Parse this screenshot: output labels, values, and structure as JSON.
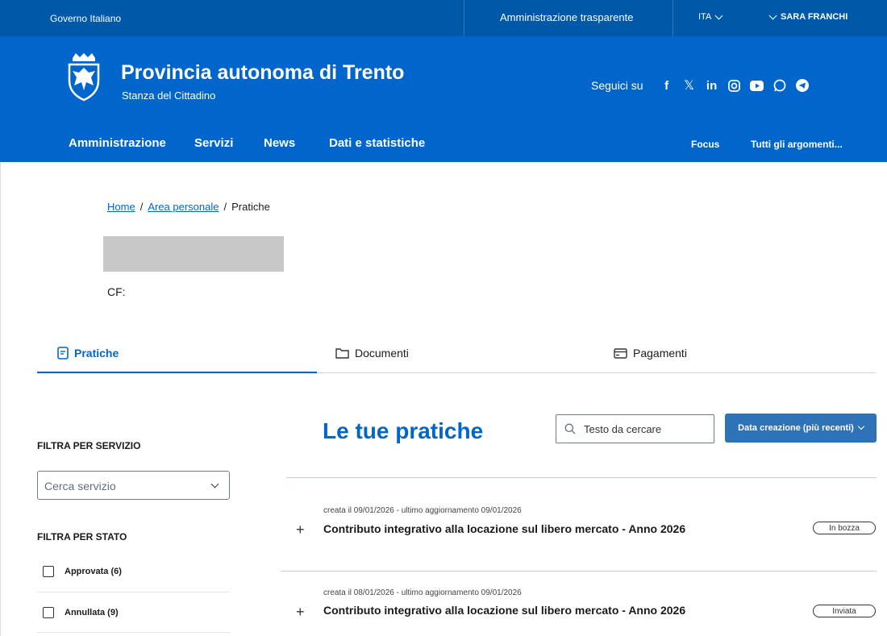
{
  "topbar": {
    "government": "Governo Italiano",
    "transparency": "Amministrazione trasparente",
    "language": "ITA",
    "user": "SARA FRANCHI"
  },
  "header": {
    "title": "Provincia autonoma di Trento",
    "subtitle": "Stanza del Cittadino",
    "follow_label": "Seguici su",
    "social_icons": [
      "facebook-icon",
      "x-icon",
      "linkedin-icon",
      "instagram-icon",
      "youtube-icon",
      "whatsapp-icon",
      "telegram-icon"
    ]
  },
  "nav": {
    "items": [
      "Amministrazione",
      "Servizi",
      "News",
      "Dati e statistiche"
    ],
    "focus": "Focus",
    "all_topics": "Tutti gli argomenti..."
  },
  "breadcrumb": {
    "home": "Home",
    "area": "Area personale",
    "current": "Pratiche",
    "separator": "/"
  },
  "profile": {
    "cf_label": "CF:"
  },
  "tabs": [
    {
      "label": "Pratiche",
      "icon": "file-icon"
    },
    {
      "label": "Documenti",
      "icon": "folder-icon"
    },
    {
      "label": "Pagamenti",
      "icon": "credit-card-icon"
    }
  ],
  "filters": {
    "service_title": "FILTRA PER SERVIZIO",
    "service_placeholder": "Cerca servizio",
    "status_title": "FILTRA PER STATO",
    "statuses": [
      "Approvata (6)",
      "Annullata (9)"
    ]
  },
  "main": {
    "title": "Le tue pratiche",
    "search_placeholder": "Testo da cercare",
    "sort_label": "Data creazione (più recenti)"
  },
  "practices": [
    {
      "meta": "creata il 09/01/2026 - ultimo aggiornamento 09/01/2026",
      "title": "Contributo integrativo alla locazione sul libero mercato - Anno 2026",
      "status": "In bozza"
    },
    {
      "meta": "creata il 08/01/2026 - ultimo aggiornamento 09/01/2026",
      "title": "Contributo integrativo alla locazione sul libero mercato - Anno 2026",
      "status": "Inviata"
    }
  ],
  "colors": {
    "topbar": "#0058a8",
    "header": "#0066cc",
    "accent": "#0066cc",
    "button": "#2e73b8"
  }
}
